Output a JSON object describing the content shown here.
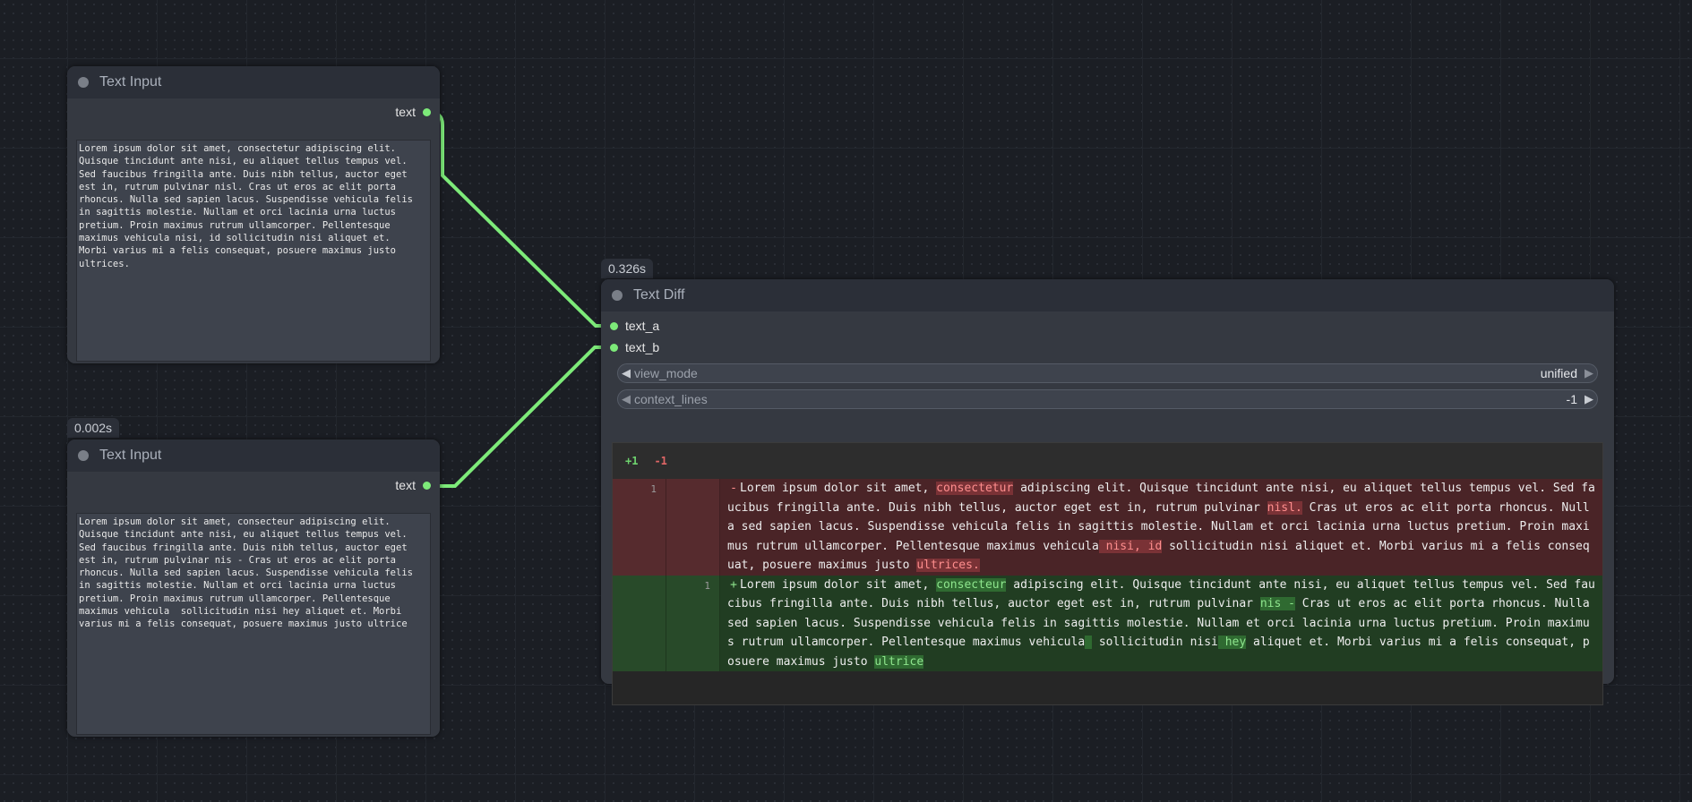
{
  "nodes": {
    "input1": {
      "title": "Text Input",
      "output_label": "text",
      "text": "Lorem ipsum dolor sit amet, consectetur adipiscing elit.\nQuisque tincidunt ante nisi, eu aliquet tellus tempus vel.\nSed faucibus fringilla ante. Duis nibh tellus, auctor eget\nest in, rutrum pulvinar nisl. Cras ut eros ac elit porta\nrhoncus. Nulla sed sapien lacus. Suspendisse vehicula felis\nin sagittis molestie. Nullam et orci lacinia urna luctus\npretium. Proin maximus rutrum ullamcorper. Pellentesque\nmaximus vehicula nisi, id sollicitudin nisi aliquet et.\nMorbi varius mi a felis consequat, posuere maximus justo\nultrices."
    },
    "input2": {
      "timing": "0.002s",
      "title": "Text Input",
      "output_label": "text",
      "text": "Lorem ipsum dolor sit amet, consecteur adipiscing elit.\nQuisque tincidunt ante nisi, eu aliquet tellus tempus vel.\nSed faucibus fringilla ante. Duis nibh tellus, auctor eget\nest in, rutrum pulvinar nis - Cras ut eros ac elit porta\nrhoncus. Nulla sed sapien lacus. Suspendisse vehicula felis\nin sagittis molestie. Nullam et orci lacinia urna luctus\npretium. Proin maximus rutrum ullamcorper. Pellentesque\nmaximus vehicula  sollicitudin nisi hey aliquet et. Morbi\nvarius mi a felis consequat, posuere maximus justo ultrice"
    },
    "diff": {
      "timing": "0.326s",
      "title": "Text Diff",
      "input_a": "text_a",
      "input_b": "text_b",
      "view_mode_label": "view_mode",
      "view_mode_value": "unified",
      "context_lines_label": "context_lines",
      "context_lines_value": "-1",
      "stats_added": "+1",
      "stats_removed": "-1",
      "removed_line_number": "1",
      "added_line_number": "1",
      "removed_segments": [
        {
          "t": "Lorem ipsum dolor sit amet, ",
          "hl": false
        },
        {
          "t": "consectetur",
          "hl": true
        },
        {
          "t": " adipiscing elit. Quisque tincidunt ante nisi, eu aliquet tellus tempus vel. Sed faucibus fringilla ante. Duis nibh tellus, auctor eget est in, rutrum pulvinar ",
          "hl": false
        },
        {
          "t": "nisl.",
          "hl": true
        },
        {
          "t": " Cras ut eros ac elit porta rhoncus. Nulla sed sapien lacus. Suspendisse vehicula felis in sagittis molestie. Nullam et orci lacinia urna luctus pretium. Proin maximus rutrum ullamcorper. Pellentesque maximus vehicula",
          "hl": false
        },
        {
          "t": " nisi, id",
          "hl": true
        },
        {
          "t": " sollicitudin nisi aliquet et. Morbi varius mi a felis consequat, posuere maximus justo ",
          "hl": false
        },
        {
          "t": "ultrices.",
          "hl": true
        }
      ],
      "added_segments": [
        {
          "t": "Lorem ipsum dolor sit amet, ",
          "hl": false
        },
        {
          "t": "consecteur",
          "hl": true
        },
        {
          "t": " adipiscing elit. Quisque tincidunt ante nisi, eu aliquet tellus tempus vel. Sed faucibus fringilla ante. Duis nibh tellus, auctor eget est in, rutrum pulvinar ",
          "hl": false
        },
        {
          "t": "nis -",
          "hl": true
        },
        {
          "t": " Cras ut eros ac elit porta rhoncus. Nulla sed sapien lacus. Suspendisse vehicula felis in sagittis molestie. Nullam et orci lacinia urna luctus pretium. Proin maximus rutrum ullamcorper. Pellentesque maximus vehicula",
          "hl": false
        },
        {
          "t": " ",
          "hl": true
        },
        {
          "t": " sollicitudin nisi",
          "hl": false
        },
        {
          "t": " hey",
          "hl": true
        },
        {
          "t": " aliquet et. Morbi varius mi a felis consequat, posuere maximus justo ",
          "hl": false
        },
        {
          "t": "ultrice",
          "hl": true
        }
      ]
    }
  },
  "colors": {
    "wire": "#7dea79",
    "port": "#7dea79"
  }
}
